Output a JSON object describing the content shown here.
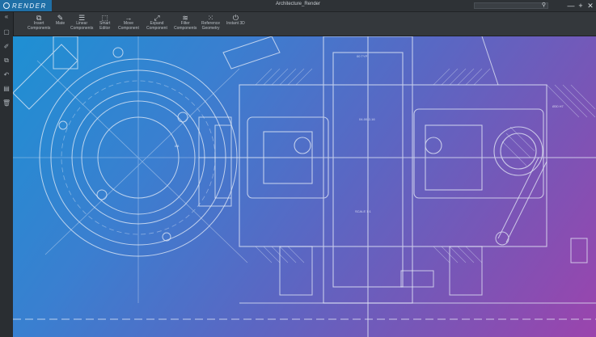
{
  "app": {
    "logo_text": "RENDER",
    "window_title": "Architecture_Render"
  },
  "window_controls": {
    "minimize": "—",
    "maximize": "+",
    "close": "✕"
  },
  "toolbar": {
    "tools": [
      {
        "id": "insert",
        "label": "Insert\nComponents",
        "icon": "insert-component-icon",
        "glyph": "⧉"
      },
      {
        "id": "mate",
        "label": "Mate",
        "icon": "mate-icon",
        "glyph": "✎"
      },
      {
        "id": "linear",
        "label": "Linear\nComponents",
        "icon": "linear-pattern-icon",
        "glyph": "☰"
      },
      {
        "id": "smart",
        "label": "Smart\nEditor",
        "icon": "smart-editor-icon",
        "glyph": "⬚"
      },
      {
        "id": "move",
        "label": "Move\nComponent",
        "icon": "move-arrow-icon",
        "glyph": "→"
      },
      {
        "id": "expand",
        "label": "Expand\nComponent",
        "icon": "expand-icon",
        "glyph": "⤢"
      },
      {
        "id": "filter",
        "label": "Filter\nComponents",
        "icon": "filter-icon",
        "glyph": "≋"
      },
      {
        "id": "reference",
        "label": "Reference\nGeometry",
        "icon": "reference-geometry-icon",
        "glyph": "⁙"
      },
      {
        "id": "instant3d",
        "label": "Instant 3D",
        "icon": "instant-3d-icon",
        "glyph": "⏻"
      }
    ]
  },
  "rail": {
    "items": [
      {
        "icon": "collapse-icon",
        "glyph": "«"
      },
      {
        "icon": "select-box-icon",
        "glyph": "▢"
      },
      {
        "icon": "edit-icon",
        "glyph": "✐"
      },
      {
        "icon": "layers-icon",
        "glyph": "⧉"
      },
      {
        "icon": "undo-icon",
        "glyph": "↶"
      },
      {
        "icon": "document-icon",
        "glyph": "▤"
      },
      {
        "icon": "trash-icon",
        "glyph": "🗑"
      }
    ]
  },
  "search": {
    "icon": "search-icon",
    "glyph": "⚲"
  },
  "colors": {
    "logo_bg": "#1f6fa6",
    "gradient_start": "#1e90d3",
    "gradient_end": "#9b44ad",
    "toolbar_bg": "#34383c"
  }
}
